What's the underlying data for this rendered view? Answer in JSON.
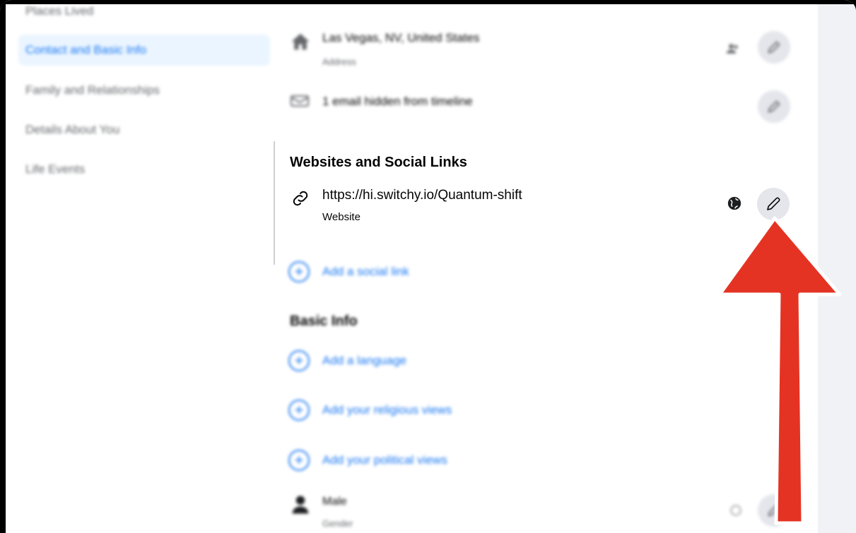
{
  "sidebar": {
    "items": [
      {
        "label": "Places Lived"
      },
      {
        "label": "Contact and Basic Info",
        "active": true
      },
      {
        "label": "Family and Relationships"
      },
      {
        "label": "Details About You"
      },
      {
        "label": "Life Events"
      }
    ]
  },
  "contact": {
    "address": {
      "value": "Las Vegas, NV, United States",
      "caption": "Address",
      "icon": "home-icon",
      "privacy_icon": "friends-icon"
    },
    "email": {
      "value": "1 email hidden from timeline",
      "icon": "email-icon"
    }
  },
  "websites": {
    "title": "Websites and Social Links",
    "website": {
      "url": "https://hi.switchy.io/Quantum-shift",
      "caption": "Website",
      "icon": "link-icon",
      "privacy_icon": "globe-icon"
    },
    "add_social": "Add a social link"
  },
  "basic_info": {
    "title": "Basic Info",
    "add_language": "Add a language",
    "add_religious": "Add your religious views",
    "add_political": "Add your political views",
    "gender": {
      "value": "Male",
      "caption": "Gender",
      "icon": "person-icon"
    }
  },
  "annotation": {
    "arrow_color": "#e53323",
    "arrow_outline": "#ffffff"
  },
  "colors": {
    "accent": "#1877f2",
    "active_bg": "#ebf5ff",
    "edit_bg": "#e4e6eb"
  }
}
